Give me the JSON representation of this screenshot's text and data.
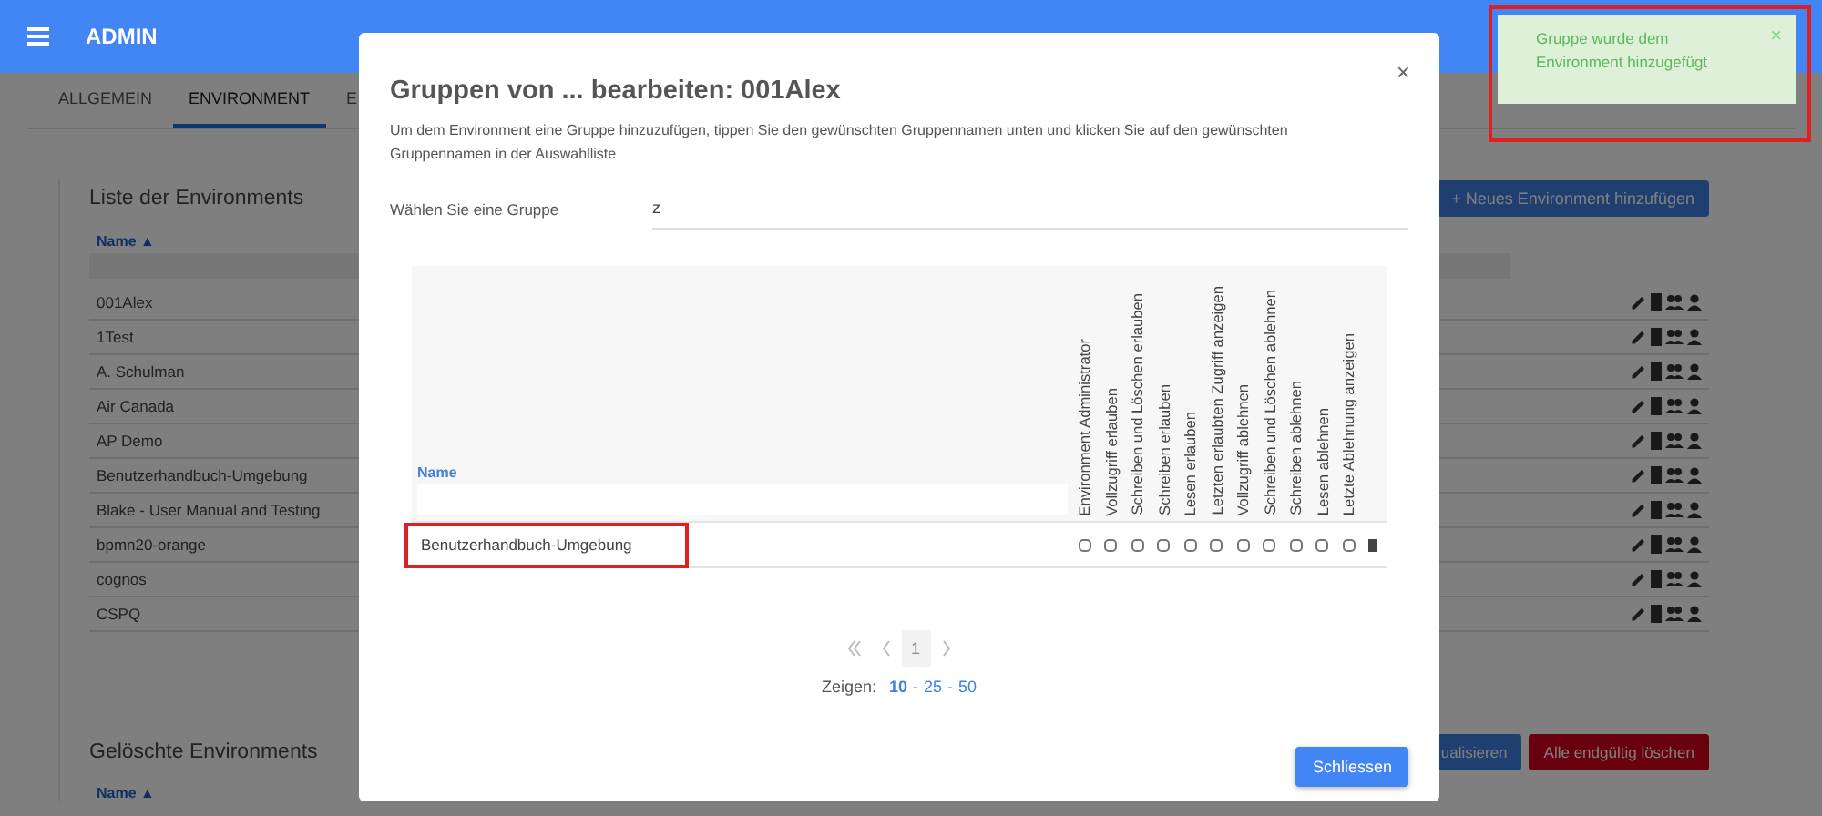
{
  "header": {
    "title": "ADMIN"
  },
  "tabs": [
    {
      "label": "ALLGEMEIN",
      "selected": false
    },
    {
      "label": "ENVIRONMENT",
      "selected": true
    },
    {
      "label": "E",
      "selected": false
    }
  ],
  "environments": {
    "title": "Liste der Environments",
    "add_button": "+ Neues Environment hinzufügen",
    "column": "Name ▲",
    "rows": [
      {
        "name": "001Alex"
      },
      {
        "name": "1Test"
      },
      {
        "name": "A. Schulman"
      },
      {
        "name": "Air Canada"
      },
      {
        "name": "AP Demo"
      },
      {
        "name": "Benutzerhandbuch-Umgebung"
      },
      {
        "name": "Blake - User Manual and Testing"
      },
      {
        "name": "bpmn20-orange"
      },
      {
        "name": "cognos"
      },
      {
        "name": "CSPQ"
      }
    ]
  },
  "deleted": {
    "title": "Gelöschte Environments",
    "column": "Name ▲",
    "buttons": [
      {
        "label": "ualisieren",
        "kind": "primary"
      },
      {
        "label": "Alle endgültig löschen",
        "kind": "danger"
      }
    ]
  },
  "dialog": {
    "title": "Gruppen von ... bearbeiten: 001Alex",
    "close": "×",
    "description": "Um dem Environment eine Gruppe hinzuzufügen, tippen Sie den gewünschten Gruppennamen unten und klicken Sie auf den gewünschten Gruppennamen in der Auswahlliste",
    "group_label": "Wählen Sie eine Gruppe",
    "group_value": "z",
    "table": {
      "name_column": "Name",
      "columns": [
        "Environment Administrator",
        "Vollzugriff erlauben",
        "Schreiben und Löschen erlauben",
        "Schreiben erlauben",
        "Lesen erlauben",
        "Letzten erlaubten Zugriff anzeigen",
        "Vollzugriff ablehnen",
        "Schreiben und Löschen ablehnen",
        "Schreiben ablehnen",
        "Lesen ablehnen",
        "Letzte Ablehnung anzeigen"
      ],
      "rows": [
        {
          "name": "Benutzerhandbuch-Umgebung",
          "highlighted": true,
          "cells": [
            {
              "checked": false
            },
            {
              "checked": false
            },
            {
              "checked": false
            },
            {
              "checked": false
            },
            {
              "checked": false
            },
            {
              "checked": false
            },
            {
              "checked": false
            },
            {
              "checked": false
            },
            {
              "checked": false
            },
            {
              "checked": false
            },
            {
              "checked": false
            }
          ]
        }
      ]
    },
    "pages": [
      {
        "label": "1",
        "selected": true
      }
    ],
    "page_size_label": "Zeigen:",
    "page_sizes": [
      {
        "label": "10",
        "selected": true
      },
      {
        "label": "25",
        "selected": false
      },
      {
        "label": "50",
        "selected": false
      }
    ],
    "separators": [
      "-",
      "-"
    ],
    "button": "Schliessen"
  },
  "toast": {
    "message": "Gruppe wurde dem Environment hinzugefügt",
    "close": "×",
    "highlighted": true
  }
}
